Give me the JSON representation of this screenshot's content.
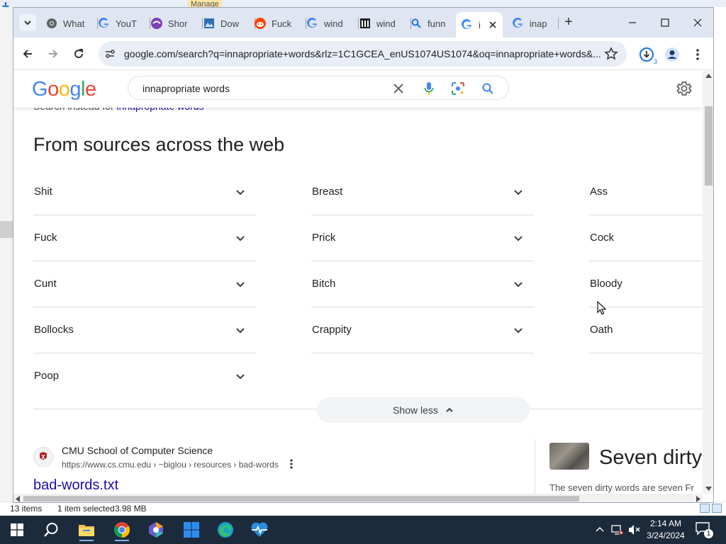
{
  "background_window": {
    "manage_label": "Manage",
    "status": {
      "items_count": "13 items",
      "selected": "1 item selected",
      "size": "3.98 MB"
    }
  },
  "tabs": [
    {
      "label": "What",
      "icon": "chrome-icon"
    },
    {
      "label": "YouT",
      "icon": "google-icon"
    },
    {
      "label": "Shor",
      "icon": "purple-app-icon"
    },
    {
      "label": "Dow",
      "icon": "image-icon"
    },
    {
      "label": "Fuck",
      "icon": "reddit-icon"
    },
    {
      "label": "wind",
      "icon": "google-icon"
    },
    {
      "label": "wind",
      "icon": "library-icon"
    },
    {
      "label": "funn",
      "icon": "search-icon"
    },
    {
      "label": "i",
      "icon": "google-icon",
      "active": true
    },
    {
      "label": "inap",
      "icon": "google-icon"
    }
  ],
  "toolbar": {
    "url": "google.com/search?q=innapropriate+words&rlz=1C1GCEA_enUS1074US1074&oq=innapropriate+words&...",
    "downloads_badge": "3"
  },
  "google": {
    "logo": "Google",
    "query": "innapropriate words",
    "search_instead_prefix": "Search instead for",
    "search_instead_link": "innapropriate words",
    "section_title": "From sources across the web",
    "words_col1": [
      "Shit",
      "Fuck",
      "Cunt",
      "Bollocks",
      "Poop"
    ],
    "words_col2": [
      "Breast",
      "Prick",
      "Bitch",
      "Crappity"
    ],
    "words_col3": [
      "Ass",
      "Cock",
      "Bloody",
      "Oath"
    ],
    "show_less": "Show less",
    "result": {
      "site": "CMU School of Computer Science",
      "crumb": "https://www.cs.cmu.edu › ~biglou › resources › bad-words",
      "title": "bad-words.txt"
    },
    "knowledge_panel": {
      "title": "Seven dirty",
      "snippet": "The seven dirty words are seven Fr"
    }
  },
  "taskbar": {
    "time": "2:14 AM",
    "date": "3/24/2024",
    "notification_count": "1"
  },
  "colors": {
    "google_blue": "#4285F4",
    "google_red": "#EA4335",
    "google_yellow": "#FBBC05",
    "google_green": "#34A853",
    "link": "#1a0dab",
    "taskbar": "#1c2b3c"
  }
}
